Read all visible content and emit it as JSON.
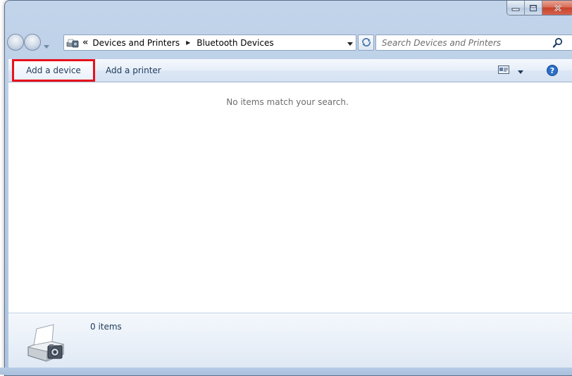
{
  "window": {
    "caption_buttons": [
      "minimize-icon",
      "maximize-icon",
      "close-icon"
    ]
  },
  "address_bar": {
    "overflow_chevron": "«",
    "breadcrumbs": [
      "Devices and Printers",
      "Bluetooth Devices"
    ],
    "location_icon": "devices-and-printers-icon"
  },
  "search": {
    "placeholder": "Search Devices and Printers",
    "value": ""
  },
  "command_bar": {
    "add_device_label": "Add a device",
    "add_printer_label": "Add a printer",
    "highlight_color": "#e8121b"
  },
  "content": {
    "empty_message": "No items match your search."
  },
  "details_pane": {
    "item_count": "0 items",
    "icon": "printer-camera-device-icon"
  },
  "colors": {
    "frame": "#b8cde6",
    "text": "#1e395b",
    "accent_red": "#e8121b"
  }
}
